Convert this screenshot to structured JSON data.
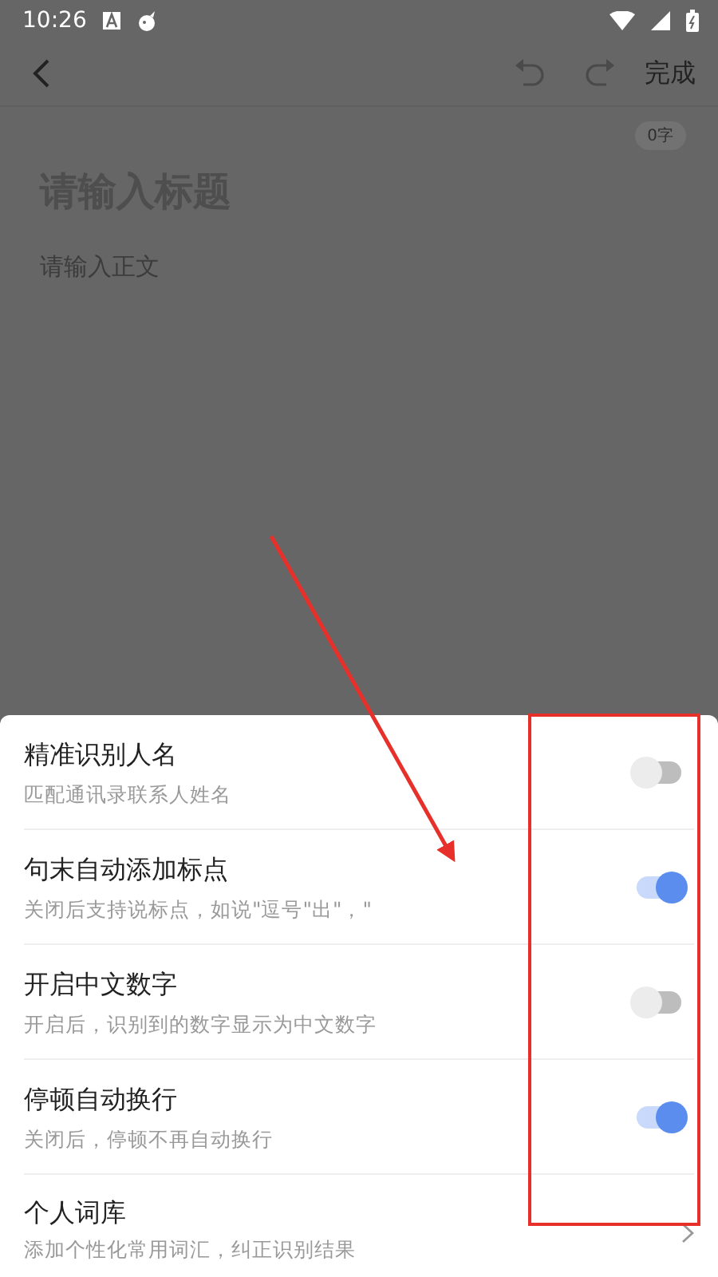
{
  "status_bar": {
    "time": "10:26"
  },
  "toolbar": {
    "done": "完成"
  },
  "editor": {
    "word_count": "0字",
    "title_placeholder": "请输入标题",
    "body_placeholder": "请输入正文"
  },
  "settings": [
    {
      "kind": "toggle",
      "title": "精准识别人名",
      "subtitle": "匹配通讯录联系人姓名",
      "on": false
    },
    {
      "kind": "toggle",
      "title": "句末自动添加标点",
      "subtitle": "关闭后支持说标点，如说\"逗号\"出\"，\"",
      "on": true
    },
    {
      "kind": "toggle",
      "title": "开启中文数字",
      "subtitle": "开启后，识别到的数字显示为中文数字",
      "on": false
    },
    {
      "kind": "toggle",
      "title": "停顿自动换行",
      "subtitle": "关闭后，停顿不再自动换行",
      "on": true
    },
    {
      "kind": "link",
      "title": "个人词库",
      "subtitle": "添加个性化常用词汇，纠正识别结果"
    }
  ]
}
